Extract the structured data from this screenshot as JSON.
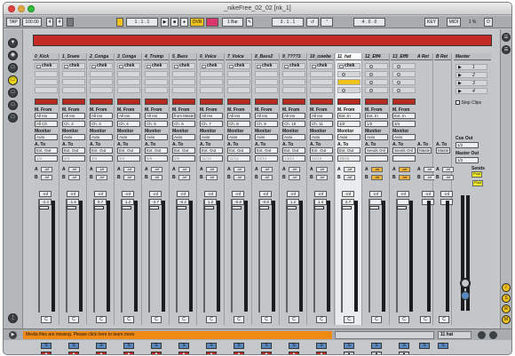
{
  "window": {
    "title": "_nikeFree_02_02  [nk_1]"
  },
  "transport": {
    "tap": "TAP",
    "tempo": "100.00",
    "sig_num": "4",
    "sig_den": "4",
    "quant": "1 Bar",
    "pos": "1 .  1 .  1",
    "ovr": "OVR",
    "loop_pos": "3 .  1 .  1",
    "loop_len": "4 .  0 .  0",
    "key": "KEY",
    "midi": "MIDI",
    "cpu": "1 %",
    "disk": "D"
  },
  "colors": {
    "clip_red": "#c22a23",
    "clip_yellow": "#f2c21c",
    "solo_blue": "#5a89c2",
    "status_orange": "#f08a14"
  },
  "tracks": [
    {
      "name": "0_Kick",
      "slot": "chek",
      "type": "midi",
      "from": "All Ins",
      "chan": "All Ch",
      "mon": "Auto",
      "to": "Ext. Out",
      "out_ch": "1/2",
      "vol": "-2.4",
      "num": "1"
    },
    {
      "name": "1_Snare",
      "slot": "chek",
      "type": "midi",
      "from": "All Ins",
      "chan": "Ch. 2",
      "mon": "Auto",
      "to": "Ext. Out",
      "out_ch": "3/4",
      "vol": "-1.6",
      "num": "2"
    },
    {
      "name": "2_Conga",
      "slot": "chek",
      "type": "midi",
      "from": "All Ins",
      "chan": "Ch. 3",
      "mon": "Auto",
      "to": "Ext. Out",
      "out_ch": "3/4",
      "vol": "0.7",
      "num": "3"
    },
    {
      "name": "3_Conga",
      "slot": "chek",
      "type": "midi",
      "from": "All Ins",
      "chan": "Ch. 4",
      "mon": "Auto",
      "to": "Ext. Out",
      "out_ch": "3/4",
      "vol": "1.2",
      "num": "4"
    },
    {
      "name": "4_Trump",
      "slot": "chek",
      "type": "midi",
      "from": "All Ins",
      "chan": "Ch. 5",
      "mon": "Auto",
      "to": "Ext. Out",
      "out_ch": "5/6",
      "vol": "-3.7",
      "num": "5"
    },
    {
      "name": "5_Bass",
      "slot": "chek",
      "type": "midi",
      "from": "from Maste",
      "chan": "Ch. 6",
      "mon": "Auto",
      "to": "Ext. Out",
      "out_ch": "5/6",
      "vol": "-0.2",
      "num": "6"
    },
    {
      "name": "6_Voice",
      "slot": "chek",
      "type": "midi",
      "from": "All Ins",
      "chan": "Ch. 7",
      "mon": "Auto",
      "to": "Ext. Out",
      "out_ch": "11/12",
      "vol": "1.2",
      "num": "7"
    },
    {
      "name": "7_Voice",
      "slot": "chek",
      "type": "midi",
      "from": "All Ins",
      "chan": "Ch. 8",
      "mon": "Auto",
      "to": "Ext. Out",
      "out_ch": "11/12",
      "vol": "-0.8",
      "num": "8"
    },
    {
      "name": "8_Bass2",
      "slot": "chek",
      "type": "midi",
      "from": "All Ins",
      "chan": "Ch. 9",
      "mon": "Auto",
      "to": "Ext. Out",
      "out_ch": "13/14",
      "vol": "-0.8",
      "num": "9"
    },
    {
      "name": "9_????3",
      "slot": "chek",
      "type": "midi",
      "from": "All Ins",
      "chan": "Ch. 10",
      "mon": "Auto",
      "to": "Ext. Out",
      "out_ch": "13/14",
      "vol": "1.2",
      "num": "10"
    },
    {
      "name": "10_cowbe",
      "slot": "chek",
      "type": "midi",
      "from": "All Ins",
      "chan": "Ch. 11",
      "mon": "Auto",
      "to": "Ext. Out",
      "out_ch": "15/16",
      "vol": "1.4",
      "num": "11"
    },
    {
      "name": "11_hat",
      "slot": "chek",
      "type": "audio",
      "from": "Ext. In",
      "chan": "1/2",
      "mon": "Auto",
      "to": "Ext. Out",
      "out_ch": "15/16",
      "vol": "2.7",
      "num": "12"
    },
    {
      "name": "12_Eff4",
      "slot": "",
      "type": "audio",
      "from": "Ext. In",
      "chan": "1/2",
      "mon": "Auto",
      "to": "Sends Onl",
      "out_ch": "",
      "vol": "",
      "num": "13"
    },
    {
      "name": "13_Eff8",
      "slot": "",
      "type": "audio",
      "from": "Ext. In",
      "chan": "3/4",
      "mon": "Auto",
      "to": "Sends Onl",
      "out_ch": "",
      "vol": "",
      "num": "14"
    }
  ],
  "returns": [
    {
      "name": "A Ret",
      "to": "Maste",
      "num": "A"
    },
    {
      "name": "B Ret",
      "to": "Maste",
      "num": "B"
    }
  ],
  "master": {
    "name": "Master",
    "scenes": [
      "1",
      "2",
      "3",
      "4"
    ],
    "stop": "Stop Clips",
    "cue_label": "Cue Out",
    "cue": "1/2",
    "out_label": "Master Out",
    "out": "1/2",
    "sends_label": "Sends",
    "post": "Post"
  },
  "labels": {
    "mfrom": "M. From",
    "monitor": "Monitor",
    "ato": "A. To",
    "inf": "-inf",
    "xfade": "C",
    "solo": "S",
    "arm": "●"
  },
  "status": {
    "message": "Media files are missing. Please click here to learn more.",
    "track": "11 hat"
  }
}
